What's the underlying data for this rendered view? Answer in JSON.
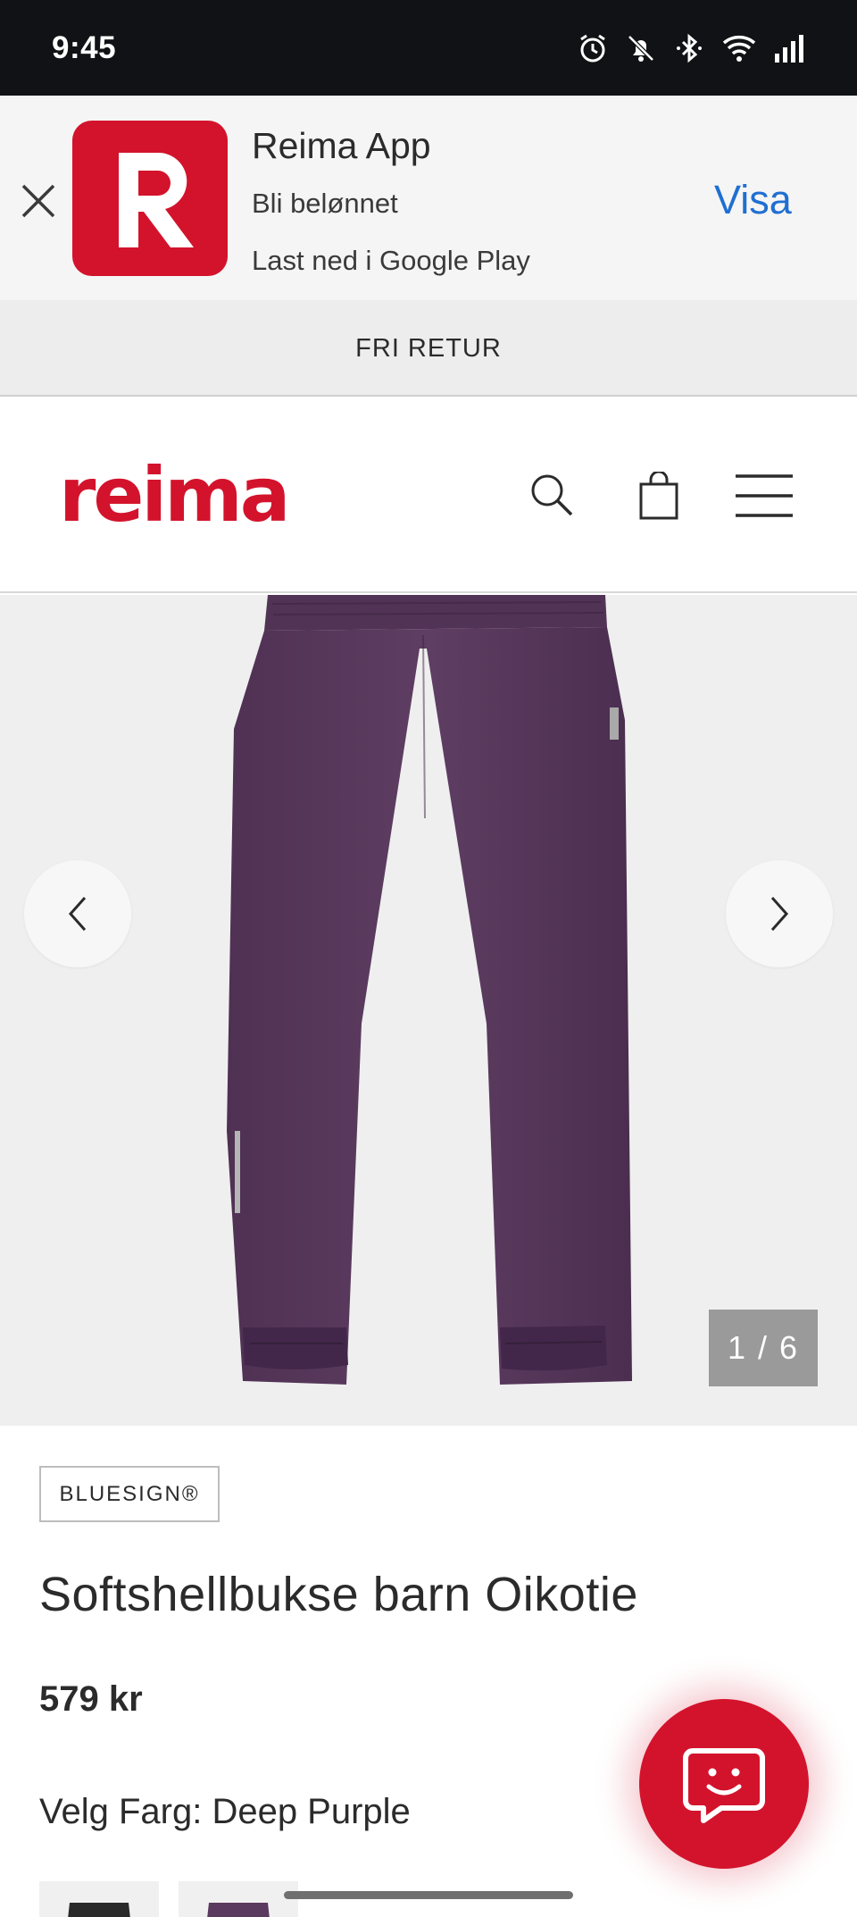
{
  "status_bar": {
    "time": "9:45",
    "icons": [
      "alarm-icon",
      "bell-off-icon",
      "bluetooth-icon",
      "wifi-icon",
      "signal-icon"
    ]
  },
  "app_banner": {
    "app_name": "Reima App",
    "line2": "Bli belønnet",
    "line3": "Last ned i Google Play",
    "cta": "Visa",
    "icon_color": "#d3132c",
    "cta_color": "#1f6fd2"
  },
  "promo": {
    "text": "FRI RETUR"
  },
  "header": {
    "logo_text": "reima",
    "brand_color": "#d3132c",
    "icons": [
      "search-icon",
      "bag-icon",
      "menu-icon"
    ]
  },
  "gallery": {
    "counter": "1 / 6",
    "current_index": 1,
    "total": 6,
    "product_color": "#5a3a5e"
  },
  "product": {
    "badge": "BLUESIGN®",
    "title": "Softshellbukse barn Oikotie",
    "price": "579 kr",
    "color_label": "Velg Farg: Deep Purple",
    "swatches": [
      {
        "name": "Black",
        "color": "#2a2a2a"
      },
      {
        "name": "Deep Purple",
        "color": "#5a3a5e"
      }
    ]
  },
  "chat": {
    "icon": "chat-face-icon"
  }
}
